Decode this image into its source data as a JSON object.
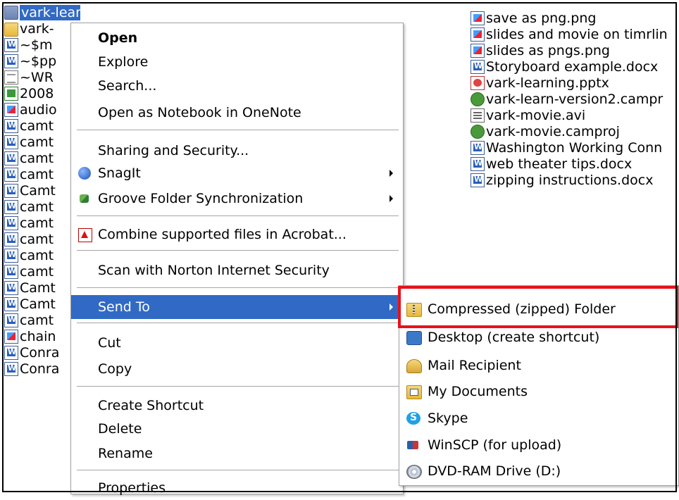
{
  "left_files": [
    {
      "name": "vark-learning",
      "icon": "folder-icon",
      "selected": true
    },
    {
      "name": "vark-",
      "icon": "folder-icon"
    },
    {
      "name": "~$m",
      "icon": "doc-icon"
    },
    {
      "name": "~$pp",
      "icon": "doc-icon"
    },
    {
      "name": "~WR",
      "icon": "text-icon"
    },
    {
      "name": "2008",
      "icon": "excel-icon"
    },
    {
      "name": "audio",
      "icon": "image-icon"
    },
    {
      "name": "camt",
      "icon": "doc-icon"
    },
    {
      "name": "camt",
      "icon": "doc-icon"
    },
    {
      "name": "camt",
      "icon": "doc-icon"
    },
    {
      "name": "camt",
      "icon": "doc-icon"
    },
    {
      "name": "Camt",
      "icon": "doc-icon"
    },
    {
      "name": "camt",
      "icon": "doc-icon"
    },
    {
      "name": "camt",
      "icon": "doc-icon"
    },
    {
      "name": "camt",
      "icon": "doc-icon"
    },
    {
      "name": "camt",
      "icon": "doc-icon"
    },
    {
      "name": "camt",
      "icon": "doc-icon"
    },
    {
      "name": "Camt",
      "icon": "doc-icon"
    },
    {
      "name": "Camt",
      "icon": "doc-icon"
    },
    {
      "name": "camt",
      "icon": "doc-icon"
    },
    {
      "name": "chain",
      "icon": "image-icon"
    },
    {
      "name": "Conra",
      "icon": "doc-icon"
    },
    {
      "name": "Conra",
      "icon": "doc-icon"
    }
  ],
  "right_files": [
    {
      "name": "save as png.png",
      "icon": "image-icon"
    },
    {
      "name": "slides and movie on timrlin",
      "icon": "image-icon"
    },
    {
      "name": "slides as pngs.png",
      "icon": "image-icon"
    },
    {
      "name": "Storyboard example.docx",
      "icon": "doc-icon"
    },
    {
      "name": "vark-learning.pptx",
      "icon": "powerpoint-icon"
    },
    {
      "name": "vark-learn-version2.campr",
      "icon": "camtasia-project-icon"
    },
    {
      "name": "vark-movie.avi",
      "icon": "video-icon"
    },
    {
      "name": "vark-movie.camproj",
      "icon": "camtasia-project-icon"
    },
    {
      "name": "Washington Working Conn",
      "icon": "doc-icon"
    },
    {
      "name": "web theater tips.docx",
      "icon": "doc-icon"
    },
    {
      "name": "zipping instructions.docx",
      "icon": "doc-icon"
    }
  ],
  "context_menu": {
    "open": "Open",
    "explore": "Explore",
    "search": "Search...",
    "open_onenote": "Open as Notebook in OneNote",
    "sharing": "Sharing and Security...",
    "snagit": "SnagIt",
    "groove": "Groove Folder Synchronization",
    "acrobat": "Combine supported files in Acrobat...",
    "norton": "Scan with Norton Internet Security",
    "send_to": "Send To",
    "cut": "Cut",
    "copy": "Copy",
    "create_shortcut": "Create Shortcut",
    "delete": "Delete",
    "rename": "Rename",
    "properties": "Properties"
  },
  "send_to_menu": {
    "compressed": "Compressed (zipped) Folder",
    "desktop": "Desktop (create shortcut)",
    "mail": "Mail Recipient",
    "my_documents": "My Documents",
    "skype": "Skype",
    "winscp": "WinSCP (for upload)",
    "dvd": "DVD-RAM Drive (D:)"
  },
  "colors": {
    "selection": "#316ac5",
    "highlight_box": "#e8111a"
  }
}
